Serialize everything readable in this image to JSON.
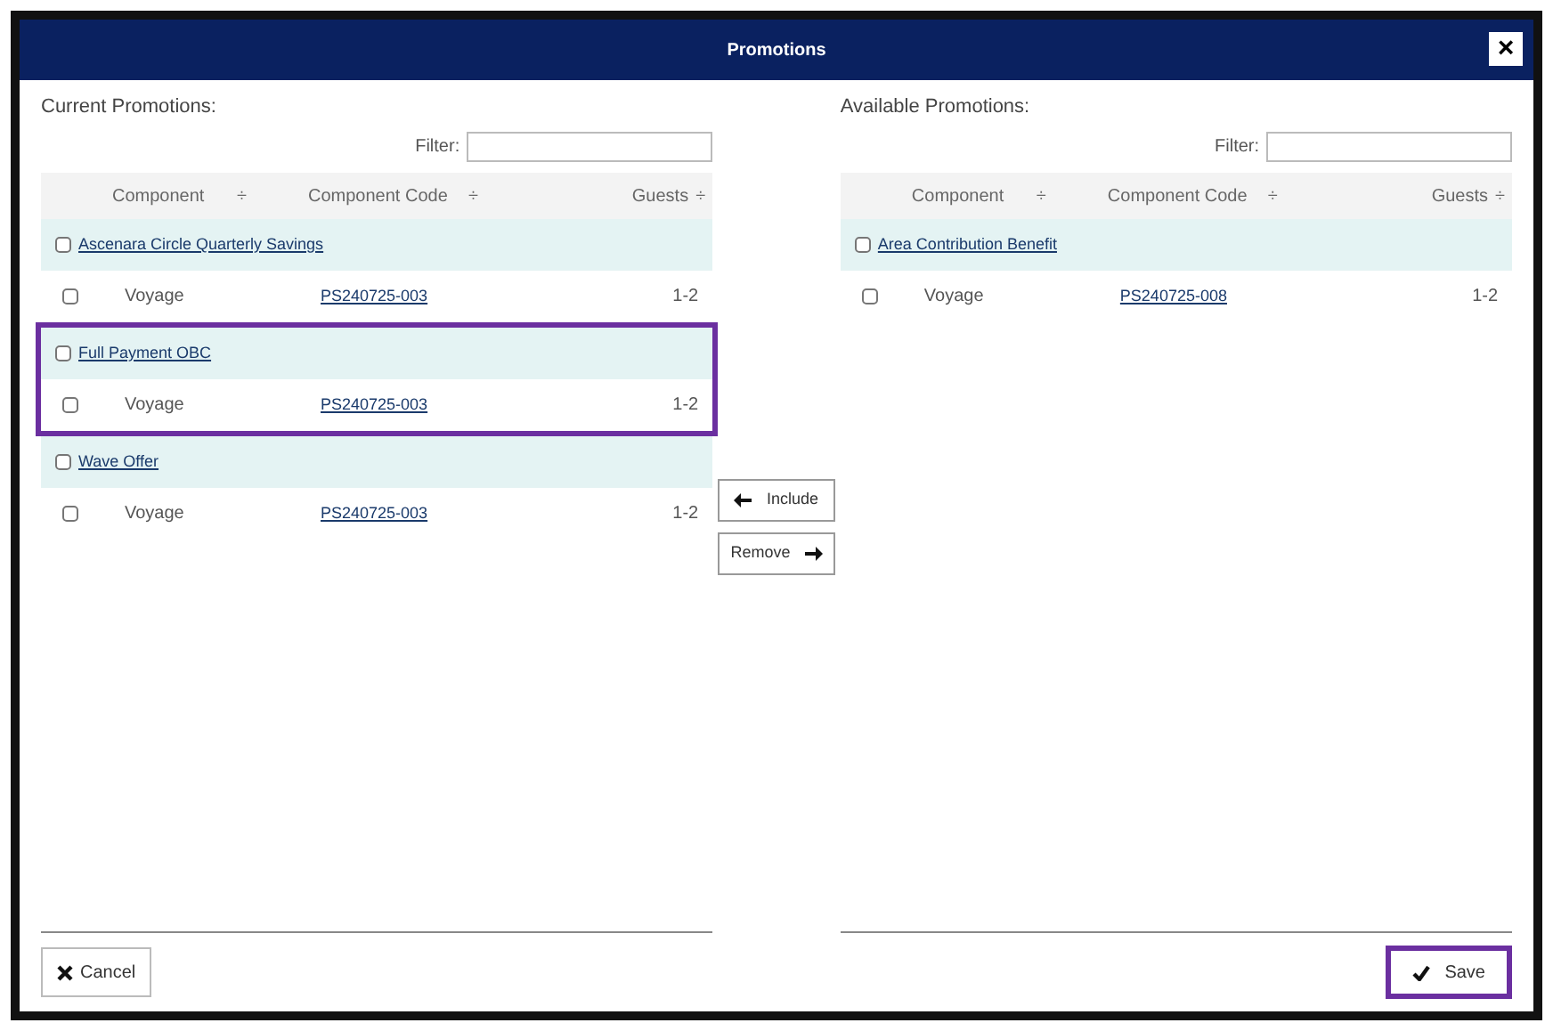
{
  "window": {
    "title": "Promotions",
    "close": "×"
  },
  "current": {
    "title": "Current Promotions:",
    "filter_label": "Filter:",
    "columns": [
      "Component",
      "Component Code",
      "Guests"
    ],
    "sort_marks": [
      "÷",
      "÷",
      "÷"
    ],
    "groups": [
      {
        "name": "Ascenara Circle Quarterly Savings",
        "highlighted": false,
        "rows": [
          {
            "component": "Voyage",
            "code": "PS240725-003",
            "guests": "1-2"
          }
        ]
      },
      {
        "name": "Full Payment OBC",
        "highlighted": true,
        "rows": [
          {
            "component": "Voyage",
            "code": "PS240725-003",
            "guests": "1-2"
          }
        ]
      },
      {
        "name": "Wave Offer",
        "highlighted": false,
        "rows": [
          {
            "component": "Voyage",
            "code": "PS240725-003",
            "guests": "1-2"
          }
        ]
      }
    ]
  },
  "middle_buttons": [
    {
      "label": "Include",
      "kind": "left"
    },
    {
      "label": "Remove",
      "kind": "right"
    }
  ],
  "available": {
    "title": "Available Promotions:",
    "filter_label": "Filter:",
    "columns": [
      "Component",
      "Component Code",
      "Guests"
    ],
    "sort_marks": [
      "÷",
      "÷",
      "÷"
    ],
    "groups": [
      {
        "name": "Area Contribution Benefit",
        "highlighted": false,
        "rows": [
          {
            "component": "Voyage",
            "code": "PS240725-008",
            "guests": "1-2"
          }
        ]
      }
    ]
  },
  "footer": {
    "cancel": "Cancel",
    "save": "Save",
    "save_highlighted": true
  }
}
